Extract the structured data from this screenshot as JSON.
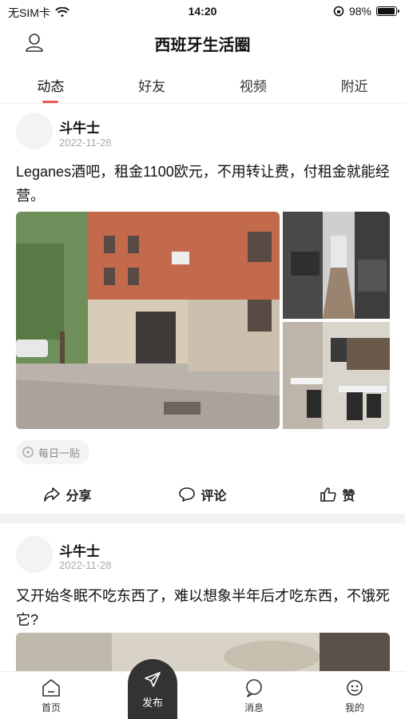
{
  "status_bar": {
    "carrier": "无SIM卡",
    "time": "14:20",
    "battery": "98%",
    "battery_level": 0.98
  },
  "header": {
    "title": "西班牙生活圈",
    "profile_icon": "person-icon"
  },
  "tabs": [
    {
      "label": "动态",
      "active": true
    },
    {
      "label": "好友",
      "active": false
    },
    {
      "label": "视频",
      "active": false
    },
    {
      "label": "附近",
      "active": false
    }
  ],
  "posts": [
    {
      "author": "斗牛士",
      "date": "2022-11-28",
      "text": "Leganes酒吧，租金1100欧元，不用转让费，付租金就能经营。",
      "tag": "每日一贴",
      "actions": {
        "share": "分享",
        "comment": "评论",
        "like": "赞"
      }
    },
    {
      "author": "斗牛士",
      "date": "2022-11-28",
      "text": "又开始冬眠不吃东西了，难以想象半年后才吃东西，不饿死它?"
    }
  ],
  "bottom_nav": {
    "home": "首页",
    "publish": "发布",
    "messages": "消息",
    "mine": "我的"
  },
  "colors": {
    "accent": "#e85c5c",
    "publish_bg": "#333333"
  }
}
